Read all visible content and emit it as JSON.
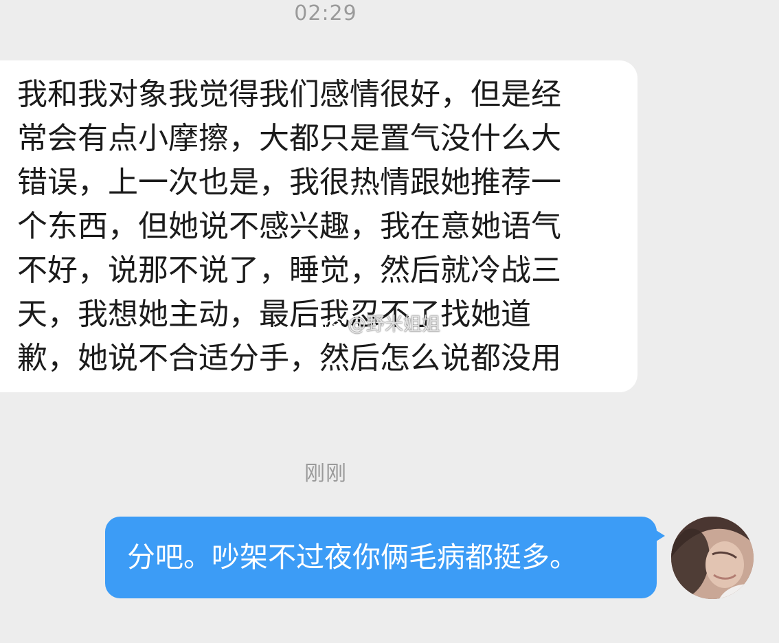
{
  "chat": {
    "timestamp_top": "02:29",
    "incoming_message": {
      "lines": [
        "我和我对象我觉得我们感情很好，但是经",
        "常会有点小摩擦，大都只是置气没什么大",
        "错误，上一次也是，我很热情跟她推荐一",
        "个东西，但她说不感兴趣，我在意她语气",
        "不好，说那不说了，睡觉，然后就冷战三",
        "天，我想她主动，最后我忍不了找她道",
        "歉，她说不合适分手，然后怎么说都没用"
      ]
    },
    "watermark": "@野米姐姐",
    "timestamp_recent": "刚刚",
    "outgoing_message": "分吧。吵架不过夜你俩毛病都挺多。"
  },
  "colors": {
    "background": "#ededed",
    "incoming_bubble": "#ffffff",
    "outgoing_bubble": "#3c9cf6",
    "timestamp_text": "#9a9a9a"
  },
  "icons": {
    "watermark_logo": "weibo-icon",
    "avatar": "user-avatar-photo"
  }
}
